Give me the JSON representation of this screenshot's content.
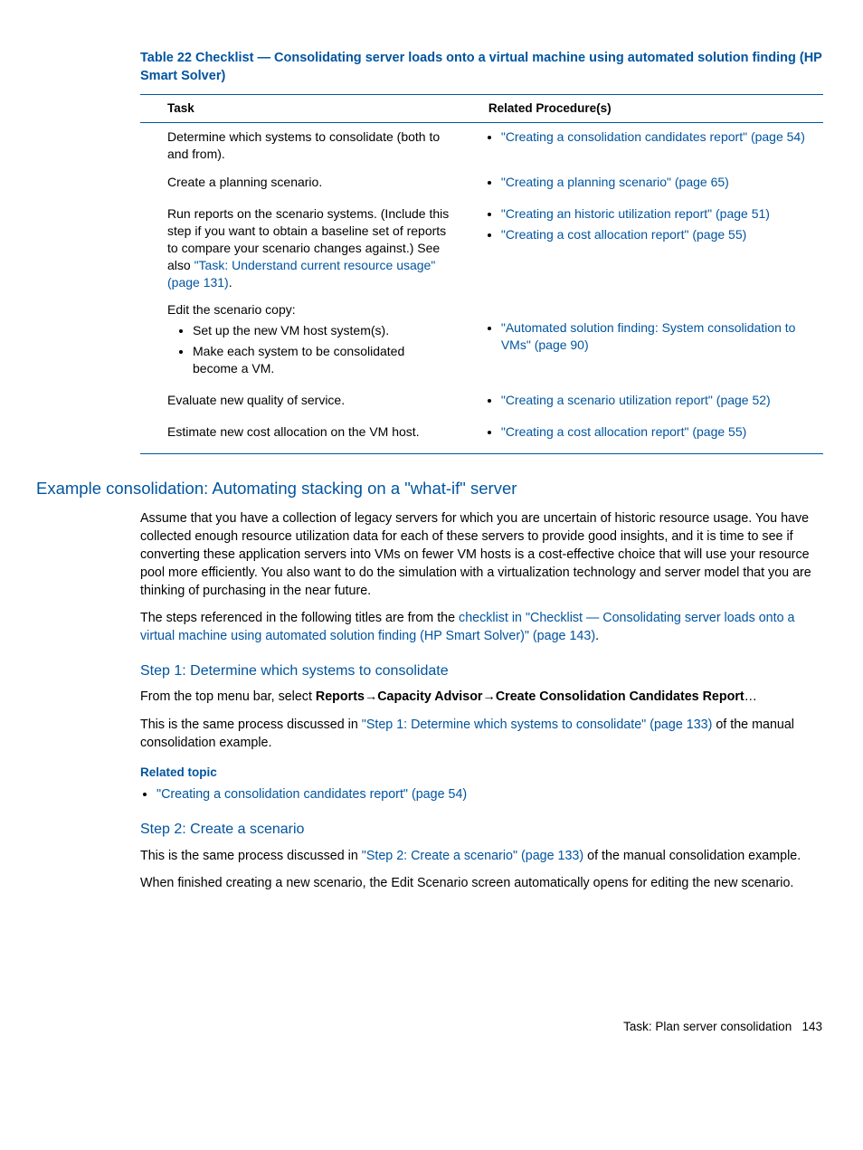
{
  "table": {
    "title": "Table 22 Checklist — Consolidating server loads onto a virtual machine using automated solution finding (HP Smart Solver)",
    "headers": {
      "task": "Task",
      "procedures": "Related Procedure(s)"
    },
    "rows": [
      {
        "task_plain": "Determine which systems to consolidate (both to and from).",
        "procedures": [
          {
            "text": "\"Creating a consolidation candidates report\" (page 54)"
          }
        ]
      },
      {
        "task_plain": "Create a planning scenario.",
        "procedures": [
          {
            "text": "\"Creating a planning scenario\" (page 65)"
          }
        ]
      },
      {
        "task_prefix": "Run reports on the scenario systems. (Include this step if you want to obtain a baseline set of reports to compare your scenario changes against.) See also ",
        "task_link": "\"Task: Understand current resource usage\" (page 131)",
        "task_suffix": ".",
        "procedures": [
          {
            "text": "\"Creating an historic utilization report\" (page 51)"
          },
          {
            "text": "\"Creating a cost allocation report\" (page 55)"
          }
        ]
      },
      {
        "task_plain": "Edit the scenario copy:",
        "subitems": [
          "Set up the new VM host system(s).",
          "Make each system to be consolidated become a VM."
        ],
        "procedures": [
          {
            "text": "\"Automated solution finding: System consolidation to VMs\" (page 90)"
          }
        ]
      },
      {
        "task_plain": "Evaluate new quality of service.",
        "procedures": [
          {
            "text": "\"Creating a scenario utilization report\" (page 52)"
          }
        ]
      },
      {
        "task_plain": "Estimate new cost allocation on the VM host.",
        "procedures": [
          {
            "text": "\"Creating a cost allocation report\" (page 55)"
          }
        ]
      }
    ]
  },
  "section": {
    "heading": "Example consolidation: Automating stacking on a \"what-if\" server",
    "para1": "Assume that you have a collection of legacy servers for which you are uncertain of historic resource usage. You have collected enough resource utilization data for each of these servers to provide good insights, and it is time to see if converting these application servers into VMs on fewer VM hosts is a cost-effective choice that will use your resource pool more efficiently. You also want to do the simulation with a virtualization technology and server model that you are thinking of purchasing in the near future.",
    "para2_prefix": "The steps referenced in the following titles are from the ",
    "para2_link": "checklist in \"Checklist — Consolidating server loads onto a virtual machine using automated solution finding (HP Smart Solver)\" (page 143)",
    "para2_suffix": "."
  },
  "step1": {
    "heading": "Step 1: Determine which systems to consolidate",
    "intro_prefix": "From the top menu bar, select ",
    "menu1": "Reports",
    "menu2": "Capacity Advisor",
    "menu3": "Create Consolidation Candidates Report",
    "intro_suffix": "…",
    "para2_prefix": "This is the same process discussed in ",
    "para2_link": "\"Step 1: Determine which systems to consolidate\" (page 133)",
    "para2_suffix": " of the manual consolidation example.",
    "related_label": "Related topic",
    "related_link": "\"Creating a consolidation candidates report\" (page 54)"
  },
  "step2": {
    "heading": "Step 2: Create a scenario",
    "para1_prefix": "This is the same process discussed in ",
    "para1_link": "\"Step 2: Create a scenario\" (page 133)",
    "para1_suffix": " of the manual consolidation example.",
    "para2": "When finished creating a new scenario, the Edit Scenario screen automatically opens for editing the new scenario."
  },
  "footer": {
    "label": "Task: Plan server consolidation",
    "page": "143"
  }
}
